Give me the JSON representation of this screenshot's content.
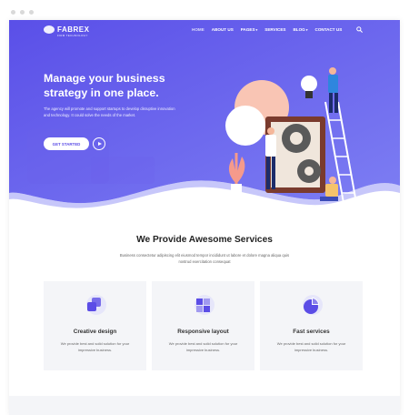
{
  "brand": {
    "name": "FABREX",
    "tagline": "FIRM TECHNOLOGY"
  },
  "nav": {
    "items": [
      {
        "label": "HOME",
        "active": true,
        "dropdown": false
      },
      {
        "label": "ABOUT US",
        "active": false,
        "dropdown": false
      },
      {
        "label": "PAGES",
        "active": false,
        "dropdown": true
      },
      {
        "label": "SERVICES",
        "active": false,
        "dropdown": false
      },
      {
        "label": "BLOG",
        "active": false,
        "dropdown": true
      },
      {
        "label": "CONTACT US",
        "active": false,
        "dropdown": false
      }
    ],
    "search_icon": "search-icon"
  },
  "hero": {
    "title": "Manage your business strategy in one place.",
    "description": "The agency will promote and support startups to develop disruptive innovation and technology. It could solve the needs of the market.",
    "cta_label": "GET STARTED",
    "play_icon": "play-icon"
  },
  "services": {
    "title": "We Provide Awesome Services",
    "subtitle": "Business consectetur adipiscing elit eiusmod tempor incididunt ut labore et dolore magna aliqua quis nostrud exercitation consequat",
    "cards": [
      {
        "icon": "layers-icon",
        "title": "Creative design",
        "text": "We provide best and solid solution for your impressive business."
      },
      {
        "icon": "grid-icon",
        "title": "Responsive layout",
        "text": "We provide best and solid solution for your impressive business."
      },
      {
        "icon": "pie-chart-icon",
        "title": "Fast services",
        "text": "We provide best and solid solution for your impressive business."
      }
    ]
  },
  "colors": {
    "hero_gradient_start": "#5a4fe8",
    "hero_gradient_end": "#7b7cf2",
    "accent": "#5b4de6",
    "card_bg": "#f4f5f8"
  }
}
